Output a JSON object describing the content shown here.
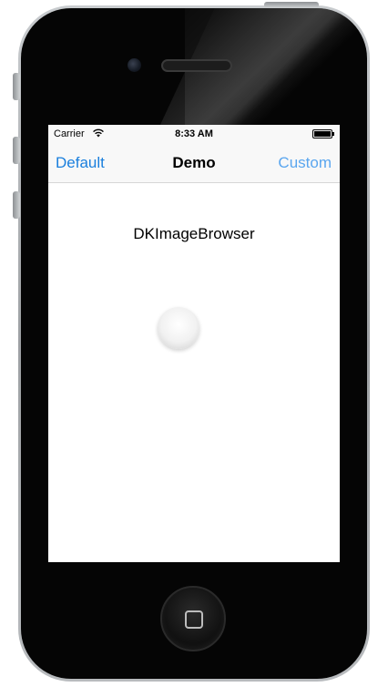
{
  "status_bar": {
    "carrier": "Carrier",
    "time": "8:33 AM",
    "wifi_icon": "wifi-icon",
    "battery_icon": "battery-icon"
  },
  "nav_bar": {
    "left_button": "Default",
    "title": "Demo",
    "right_button": "Custom"
  },
  "content": {
    "title": "DKImageBrowser"
  },
  "colors": {
    "accent": "#1a7fdd",
    "accent_light": "#5aa6ef",
    "nav_background": "#f8f8f8",
    "phone_body": "#050505"
  },
  "device": {
    "home_button_icon": "home-square-icon"
  }
}
